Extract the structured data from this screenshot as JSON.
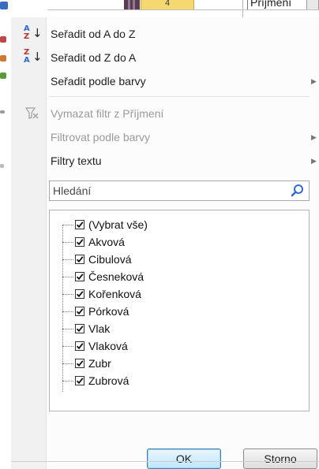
{
  "header": {
    "number_cell": "4",
    "column_label": "Příjmení"
  },
  "menu": {
    "sort_asc": "Seřadit od A do Z",
    "sort_desc": "Seřadit od Z do A",
    "sort_color": "Seřadit podle barvy",
    "clear_filter": "Vymazat filtr z Příjmení",
    "filter_color": "Filtrovat podle barvy",
    "text_filters": "Filtry textu"
  },
  "icons": {
    "sort_asc": "sort-ascending-icon",
    "sort_desc": "sort-descending-icon",
    "clear_filter": "clear-filter-icon",
    "submenu": "chevron-right-icon",
    "search": "magnifier-icon",
    "checkbox": "checkmark-icon"
  },
  "search": {
    "placeholder": "Hledání"
  },
  "list": {
    "items": [
      {
        "label": "(Vybrat vše)",
        "checked": true
      },
      {
        "label": "Akvová",
        "checked": true
      },
      {
        "label": "Cibulová",
        "checked": true
      },
      {
        "label": "Česneková",
        "checked": true
      },
      {
        "label": "Kořenková",
        "checked": true
      },
      {
        "label": "Pórková",
        "checked": true
      },
      {
        "label": "Vlak",
        "checked": true
      },
      {
        "label": "Vlaková",
        "checked": true
      },
      {
        "label": "Zubr",
        "checked": true
      },
      {
        "label": "Zubrová",
        "checked": true
      }
    ]
  },
  "buttons": {
    "ok": "OK",
    "cancel": "Storno"
  },
  "colors": {
    "accent": "#2f6bd2",
    "ok_border": "#3c7fb1",
    "header_highlight": "#f5d970"
  }
}
